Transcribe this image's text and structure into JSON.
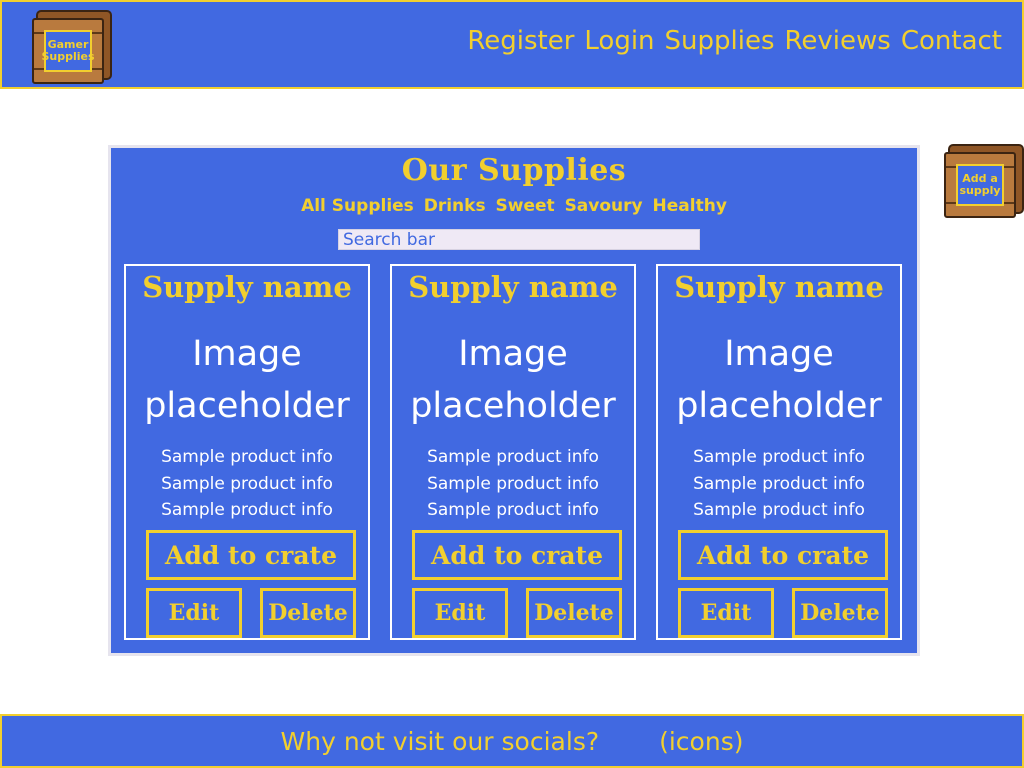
{
  "header": {
    "logo_text": "Gamer Supplies",
    "nav": [
      "Register",
      "Login",
      "Supplies",
      "Reviews",
      "Contact"
    ]
  },
  "main": {
    "title": "Our Supplies",
    "filters": [
      "All Supplies",
      "Drinks",
      "Sweet",
      "Savoury",
      "Healthy"
    ],
    "search": {
      "placeholder": "Search bar",
      "value": ""
    },
    "cards": [
      {
        "name": "Supply name",
        "image_line1": "Image",
        "image_line2": "placeholder",
        "info": [
          "Sample product info",
          "Sample product info",
          "Sample product info"
        ],
        "add_label": "Add to crate",
        "edit_label": "Edit",
        "delete_label": "Delete"
      },
      {
        "name": "Supply name",
        "image_line1": "Image",
        "image_line2": "placeholder",
        "info": [
          "Sample product info",
          "Sample product info",
          "Sample product info"
        ],
        "add_label": "Add to crate",
        "edit_label": "Edit",
        "delete_label": "Delete"
      },
      {
        "name": "Supply name",
        "image_line1": "Image",
        "image_line2": "placeholder",
        "info": [
          "Sample product info",
          "Sample product info",
          "Sample product info"
        ],
        "add_label": "Add to crate",
        "edit_label": "Edit",
        "delete_label": "Delete"
      }
    ]
  },
  "add_supply": {
    "label": "Add a supply",
    "icon": "crate-icon"
  },
  "footer": {
    "text": "Why not visit our socials?",
    "icons_placeholder": "(icons)"
  },
  "colors": {
    "primary": "#4169e1",
    "accent": "#f2cf2e",
    "text_light": "#ffffff",
    "panel_border": "#e6e4ee"
  }
}
